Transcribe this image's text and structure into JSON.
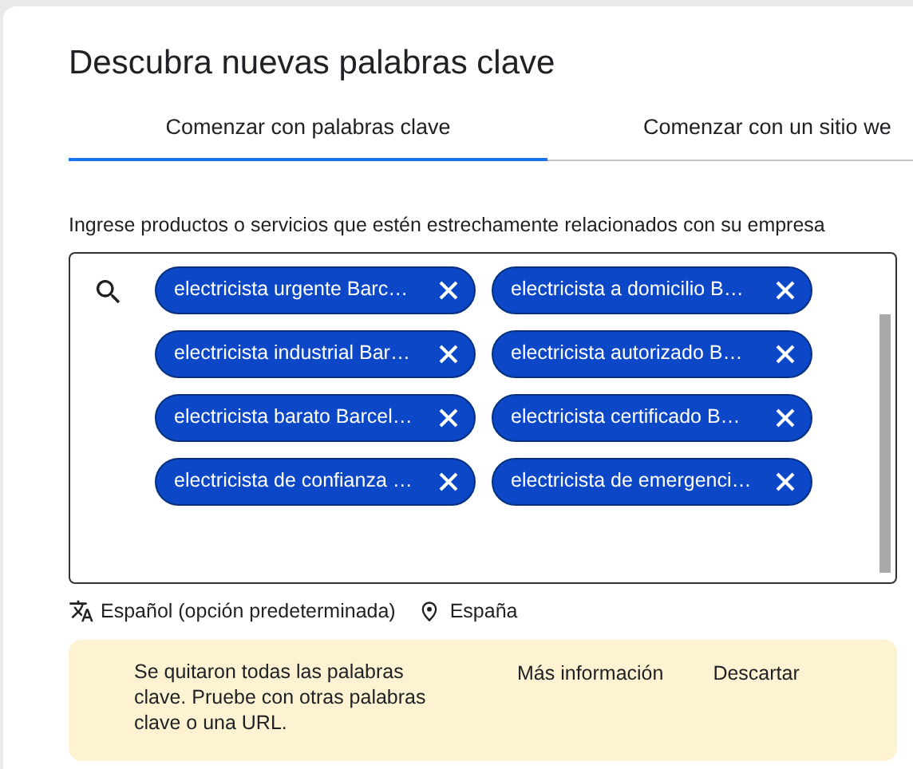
{
  "dialog": {
    "title": "Descubra nuevas palabras clave"
  },
  "tabs": [
    {
      "label": "Comenzar con palabras clave",
      "selected": true
    },
    {
      "label": "Comenzar con un sitio we",
      "selected": false
    }
  ],
  "keywords_field": {
    "label": "Ingrese productos o servicios que estén estrechamente relacionados con su empresa",
    "chips": [
      "electricista urgente Barc…",
      "electricista a domicilio B…",
      "electricista industrial Bar…",
      "electricista autorizado B…",
      "electricista barato Barcel…",
      "electricista certificado B…",
      "electricista de confianza …",
      "electricista de emergenci…"
    ]
  },
  "language": "Español (opción predeterminada)",
  "location": "España",
  "notice": {
    "message": "Se quitaron todas las palabras clave. Pruebe con otras palabras clave o una URL.",
    "actions": [
      "Más información",
      "Descartar"
    ]
  }
}
